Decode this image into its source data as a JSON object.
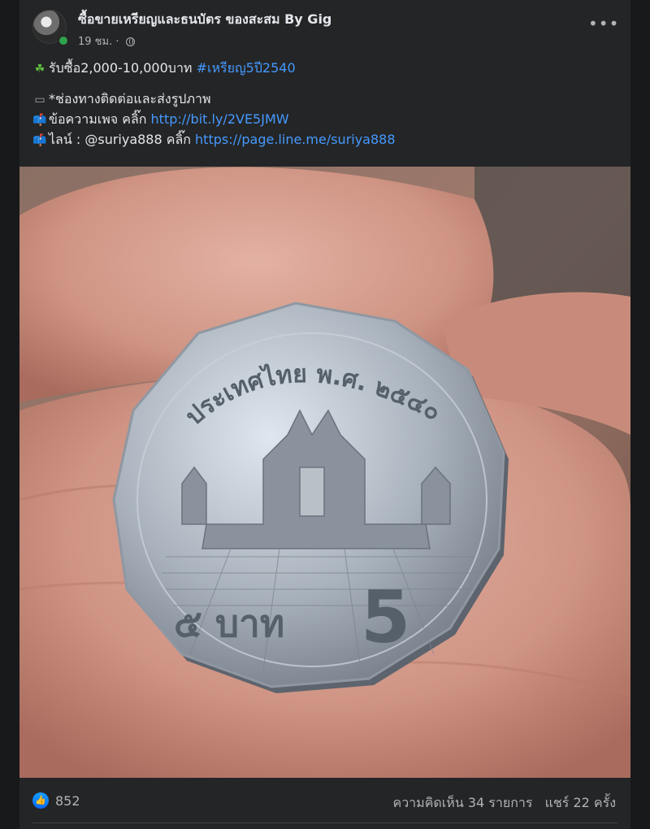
{
  "post": {
    "page_name": "ซื้อขายเหรียญและธนบัตร ของสะสม By Gig",
    "time": "19 ชม.",
    "separator": "·",
    "menu_label": "•••",
    "lines": {
      "offer_text": "รับซื้อ2,000-10,000บาท ",
      "hashtag": "#เหรียญ5ปี2540",
      "contact_heading": "*ช่องทางติดต่อและส่งรูปภาพ",
      "message_label": "ข้อความเพจ คลิ๊ก ",
      "message_link": "http://bit.ly/2VE5JMW",
      "line_label": "ไลน์ : @suriya888 คลิ๊ก ",
      "line_link": "https://page.line.me/suriya888"
    },
    "icons": {
      "clover": "☘",
      "camera": "▭",
      "mailbox": "📫"
    }
  },
  "photo": {
    "subject": "coin-in-hand",
    "coin_legend": "ประเทศไทย พ.ศ. ๒๕๔๐",
    "coin_denomination_thai": "๕ บาท",
    "coin_denomination_numeral": "5"
  },
  "footer": {
    "like_count": "852",
    "comments": "ความคิดเห็น 34 รายการ",
    "shares": "แชร์ 22 ครั้ง"
  },
  "colors": {
    "background": "#18191a",
    "card": "#242526",
    "link": "#4599ff",
    "secondary_text": "#b0b3b8"
  }
}
